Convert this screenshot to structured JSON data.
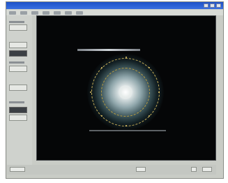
{
  "window": {
    "title": ""
  },
  "menu": {
    "items": [
      "",
      "",
      "",
      "",
      "",
      "",
      ""
    ]
  },
  "toolpanel": {
    "buttons": [
      "",
      "",
      "",
      "",
      "",
      ""
    ]
  },
  "viewer": {
    "image": "diffraction-pattern"
  },
  "status": {
    "fields": [
      "",
      "",
      ""
    ]
  },
  "colors": {
    "titlebar": "#1e52c8",
    "viewport_bg": "#050607",
    "ring": "#cbb25a",
    "panel": "#cfd2cd"
  }
}
